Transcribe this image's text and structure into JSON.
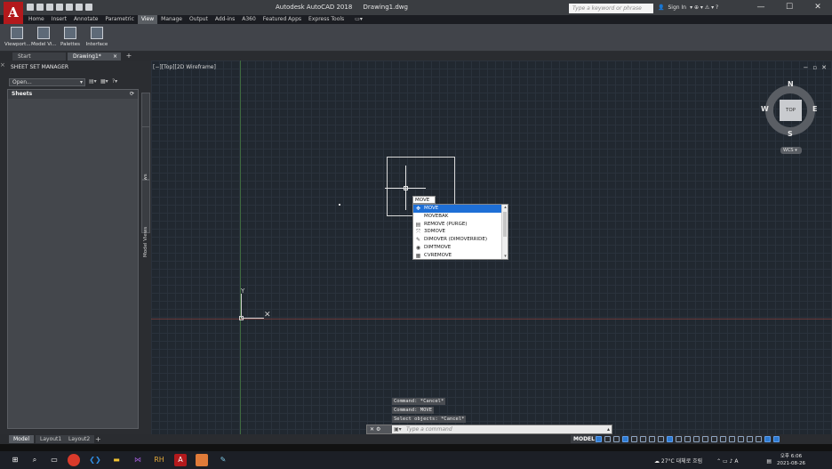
{
  "window": {
    "app_title": "Autodesk AutoCAD 2018",
    "doc_title": "Drawing1.dwg",
    "search_placeholder": "Type a keyword or phrase",
    "signin_label": "Sign In",
    "minimize": "—",
    "maximize": "☐",
    "close": "✕"
  },
  "app_button": {
    "label": "A"
  },
  "ribbon": {
    "tabs": [
      "Home",
      "Insert",
      "Annotate",
      "Parametric",
      "View",
      "Manage",
      "Output",
      "Add-ins",
      "A360",
      "Featured Apps",
      "Express Tools"
    ],
    "active_tab": "View",
    "buttons": [
      "Viewport...",
      "Model Vi...",
      "Palettes",
      "Interface"
    ]
  },
  "doc_tabs": {
    "start": "Start",
    "drawing": "Drawing1*",
    "close": "×",
    "add": "+"
  },
  "sheet_set_manager": {
    "title": "SHEET SET MANAGER",
    "open_value": "Open...",
    "panel_header": "Sheets",
    "side_tabs": [
      "Sheet List",
      "Sheet Views",
      "Model Views"
    ]
  },
  "canvas": {
    "viewport_label": "[−][Top][2D Wireframe]",
    "controls": [
      "−",
      "▫",
      "✕"
    ],
    "viewcube": {
      "n": "N",
      "s": "S",
      "e": "E",
      "w": "W",
      "face": "TOP",
      "wcs": "WCS ▾"
    },
    "ucs": {
      "y": "Y",
      "x": "✕"
    }
  },
  "autocomplete": {
    "typed": "MOVE",
    "items": [
      {
        "label": "MOVE",
        "icon": "move-icon",
        "glyph": "✥"
      },
      {
        "label": "MOVEBAK",
        "icon": "blank-icon",
        "glyph": ""
      },
      {
        "label": "REMOVE (PURGE)",
        "icon": "purge-icon",
        "glyph": "▤"
      },
      {
        "label": "3DMOVE",
        "icon": "3dmove-icon",
        "glyph": "⤧"
      },
      {
        "label": "DIMOVER (DIMOVERRIDE)",
        "icon": "dimoverride-icon",
        "glyph": "✎"
      },
      {
        "label": "DIMTMOVE",
        "icon": "dimtmove-icon",
        "glyph": "◉"
      },
      {
        "label": "CVREMOVE",
        "icon": "cvremove-icon",
        "glyph": "▦"
      }
    ]
  },
  "command": {
    "history": [
      "Command: *Cancel*",
      "Command: MOVE",
      "Select objects: *Cancel*"
    ],
    "input_placeholder": "Type a command",
    "prompt_icon": "▣▾"
  },
  "layout_tabs": {
    "tabs": [
      "Model",
      "Layout1",
      "Layout2"
    ],
    "active": "Model",
    "add": "+"
  },
  "statusbar": {
    "model_label": "MODEL"
  },
  "taskbar": {
    "weather": "27°C 대체로 흐림",
    "ime": "A",
    "time": "오후 6:06",
    "date": "2021-08-26"
  }
}
